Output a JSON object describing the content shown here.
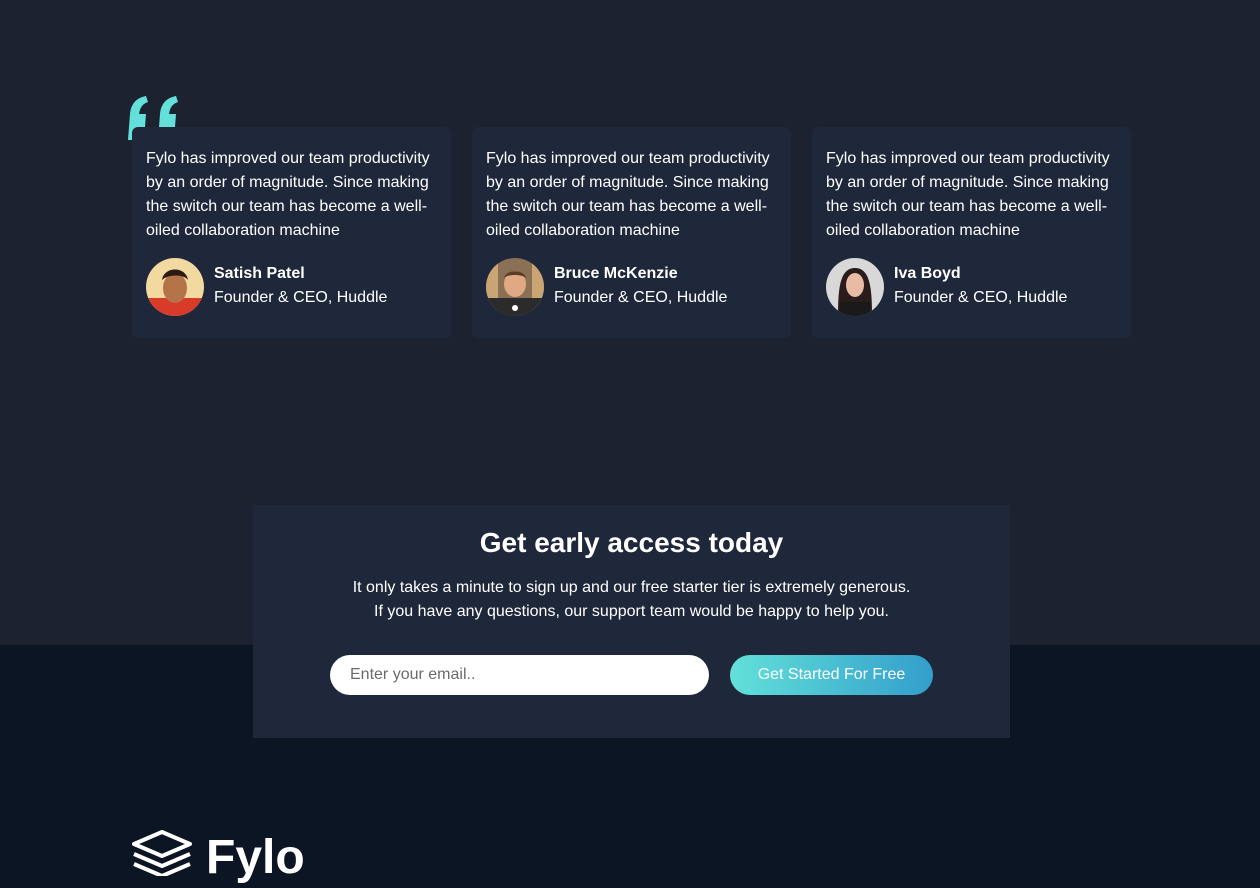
{
  "colors": {
    "accent": "#62e0d9",
    "gradient_end": "#339ecc",
    "top_bg": "#1c2230",
    "card_bg": "#1f283a",
    "footer_bg": "#0c1524"
  },
  "testimonials": [
    {
      "text": "Fylo has improved our team productivity by an order of magnitude. Since making the switch our team has become a well-oiled collaboration machine",
      "name": "Satish Patel",
      "role": "Founder & CEO, Huddle"
    },
    {
      "text": "Fylo has improved our team productivity by an order of magnitude. Since making the switch our team has become a well-oiled collaboration machine",
      "name": "Bruce McKenzie",
      "role": "Founder & CEO, Huddle"
    },
    {
      "text": "Fylo has improved our team productivity by an order of magnitude. Since making the switch our team has become a well-oiled collaboration machine",
      "name": "Iva Boyd",
      "role": "Founder & CEO, Huddle"
    }
  ],
  "cta": {
    "title": "Get early access today",
    "line1": "It only takes a minute to sign up and our free starter tier is extremely generous.",
    "line2": "If you have any questions, our support team would be happy to help you.",
    "email_placeholder": "Enter your email..",
    "button_label": "Get Started For Free"
  },
  "footer": {
    "logo_text": "Fylo"
  }
}
